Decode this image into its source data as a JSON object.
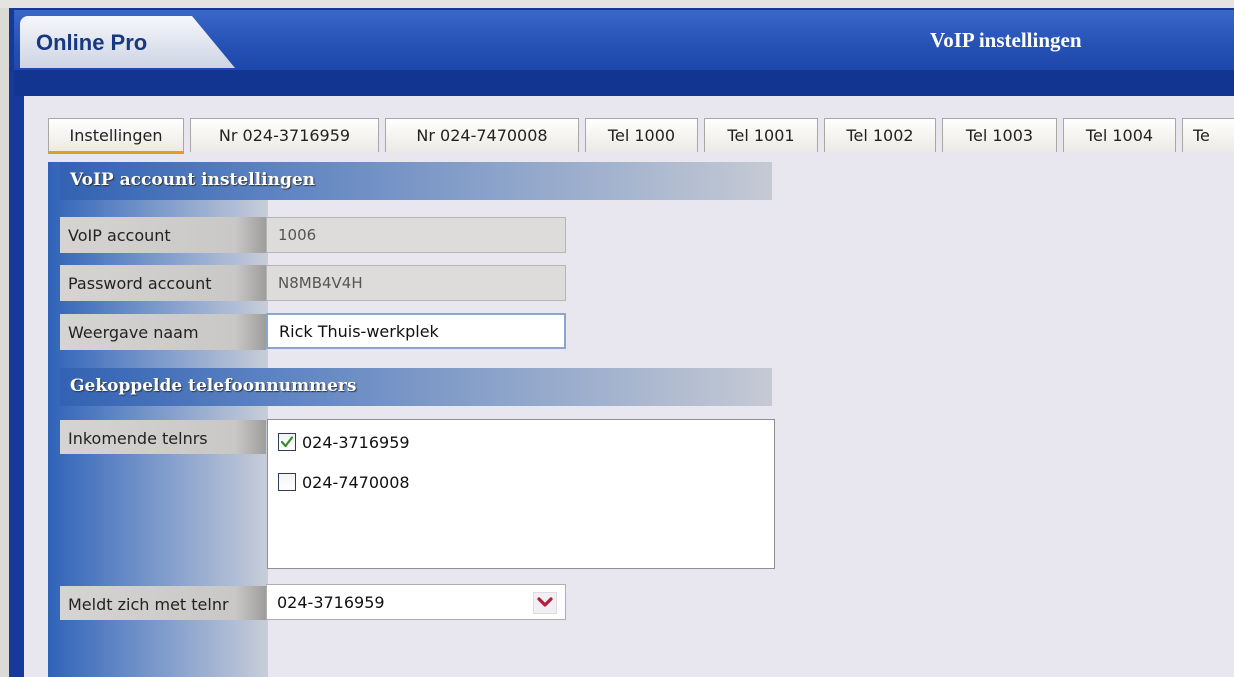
{
  "app": {
    "name": "Online Pro",
    "window_title": "VoIP instellingen"
  },
  "tabs": [
    {
      "label": "Instellingen",
      "active": true
    },
    {
      "label": "Nr 024-3716959"
    },
    {
      "label": "Nr 024-7470008"
    },
    {
      "label": "Tel 1000"
    },
    {
      "label": "Tel 1001"
    },
    {
      "label": "Tel 1002"
    },
    {
      "label": "Tel 1003"
    },
    {
      "label": "Tel 1004"
    },
    {
      "label": "Te"
    }
  ],
  "account_section": {
    "title": "VoIP  account instellingen",
    "voip_account": {
      "label": "VoIP account",
      "value": "1006"
    },
    "password": {
      "label": "Password account",
      "value": "N8MB4V4H"
    },
    "display_name": {
      "label": "Weergave naam",
      "value": "Rick Thuis-werkplek"
    }
  },
  "numbers_section": {
    "title": "Gekoppelde telefoonnummers",
    "incoming_label": "Inkomende telnrs",
    "incoming": [
      {
        "number": "024-3716959",
        "checked": true
      },
      {
        "number": "024-7470008",
        "checked": false
      }
    ],
    "outgoing_label": "Meldt zich met telnr",
    "outgoing_value": "024-3716959"
  },
  "colors": {
    "accent_blue": "#2450b4",
    "active_tab_underline": "#e39b2a",
    "checkmark": "#2f8f2f",
    "dropdown_arrow": "#b0203c"
  },
  "icons": {
    "checkbox_check": "check-icon",
    "dropdown": "chevron-down-icon"
  }
}
